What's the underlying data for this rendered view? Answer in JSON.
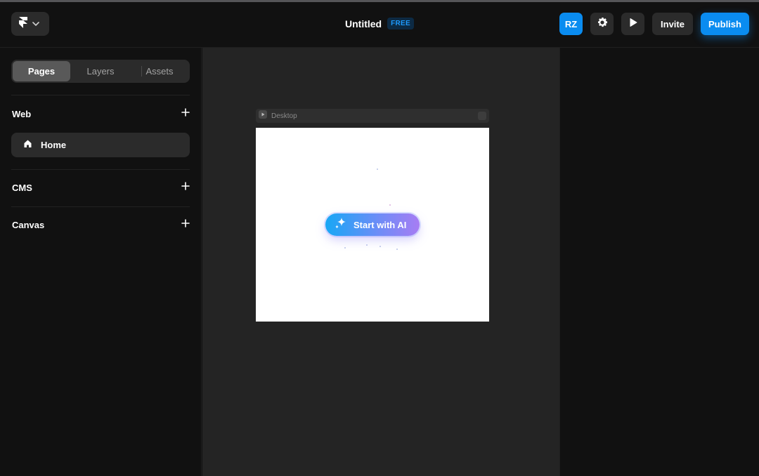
{
  "header": {
    "title": "Untitled",
    "plan_badge": "FREE",
    "avatar_initials": "RZ",
    "invite_label": "Invite",
    "publish_label": "Publish",
    "icons": [
      "framer-logo-icon",
      "chevron-down-icon",
      "gear-icon",
      "play-icon"
    ]
  },
  "sidebar": {
    "tabs": [
      {
        "label": "Pages",
        "active": true
      },
      {
        "label": "Layers",
        "active": false
      },
      {
        "label": "Assets",
        "active": false
      }
    ],
    "sections": [
      {
        "label": "Web",
        "items": [
          {
            "label": "Home",
            "icon": "home-icon"
          }
        ]
      },
      {
        "label": "CMS",
        "items": []
      },
      {
        "label": "Canvas",
        "items": []
      }
    ]
  },
  "canvas": {
    "frame_label": "Desktop",
    "ai_button_label": "Start with AI"
  },
  "colors": {
    "accent": "#0a8cf0",
    "background": "#111111",
    "canvas": "#242424",
    "button": "#2b2b2b"
  }
}
